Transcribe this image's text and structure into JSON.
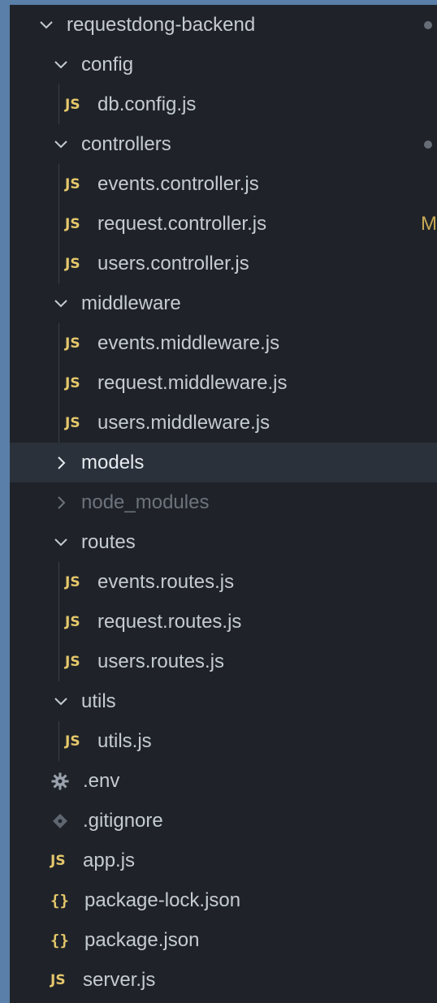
{
  "colors": {
    "background": "#1f2329",
    "selected_row": "#2b313a",
    "js_icon": "#e5c76b",
    "modified_letter": "#c7a955",
    "text": "#c5cbd3",
    "dim_text": "#6c737d"
  },
  "tree": [
    {
      "name": "root-folder",
      "label": "requestdong-backend",
      "type": "folder",
      "expanded": true,
      "level": 0,
      "status": "dot"
    },
    {
      "name": "folder-config",
      "label": "config",
      "type": "folder",
      "expanded": true,
      "level": 1
    },
    {
      "name": "file-db-config",
      "label": "db.config.js",
      "type": "js",
      "level": 2
    },
    {
      "name": "folder-controllers",
      "label": "controllers",
      "type": "folder",
      "expanded": true,
      "level": 1,
      "status": "dot"
    },
    {
      "name": "file-events-controller",
      "label": "events.controller.js",
      "type": "js",
      "level": 2
    },
    {
      "name": "file-request-controller",
      "label": "request.controller.js",
      "type": "js",
      "level": 2,
      "status": "letter",
      "status_text": "M"
    },
    {
      "name": "file-users-controller",
      "label": "users.controller.js",
      "type": "js",
      "level": 2
    },
    {
      "name": "folder-middleware",
      "label": "middleware",
      "type": "folder",
      "expanded": true,
      "level": 1
    },
    {
      "name": "file-events-middleware",
      "label": "events.middleware.js",
      "type": "js",
      "level": 2
    },
    {
      "name": "file-request-middleware",
      "label": "request.middleware.js",
      "type": "js",
      "level": 2
    },
    {
      "name": "file-users-middleware",
      "label": "users.middleware.js",
      "type": "js",
      "level": 2
    },
    {
      "name": "folder-models",
      "label": "models",
      "type": "folder",
      "expanded": false,
      "level": 1,
      "selected": true
    },
    {
      "name": "folder-node-modules",
      "label": "node_modules",
      "type": "folder",
      "expanded": false,
      "level": 1,
      "dim": true
    },
    {
      "name": "folder-routes",
      "label": "routes",
      "type": "folder",
      "expanded": true,
      "level": 1
    },
    {
      "name": "file-events-routes",
      "label": "events.routes.js",
      "type": "js",
      "level": 2
    },
    {
      "name": "file-request-routes",
      "label": "request.routes.js",
      "type": "js",
      "level": 2
    },
    {
      "name": "file-users-routes",
      "label": "users.routes.js",
      "type": "js",
      "level": 2
    },
    {
      "name": "folder-utils",
      "label": "utils",
      "type": "folder",
      "expanded": true,
      "level": 1
    },
    {
      "name": "file-utils",
      "label": "utils.js",
      "type": "js",
      "level": 2
    },
    {
      "name": "file-env",
      "label": ".env",
      "type": "gear",
      "level": 1
    },
    {
      "name": "file-gitignore",
      "label": ".gitignore",
      "type": "diamond",
      "level": 1
    },
    {
      "name": "file-app",
      "label": "app.js",
      "type": "js",
      "level": 1
    },
    {
      "name": "file-package-lock",
      "label": "package-lock.json",
      "type": "json",
      "level": 1
    },
    {
      "name": "file-package",
      "label": "package.json",
      "type": "json",
      "level": 1
    },
    {
      "name": "file-server",
      "label": "server.js",
      "type": "js",
      "level": 1
    }
  ],
  "icons": {
    "js": "JS",
    "json": "{}"
  }
}
